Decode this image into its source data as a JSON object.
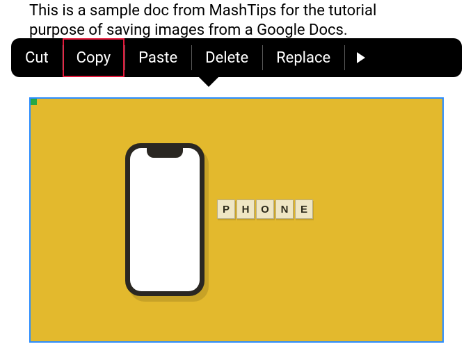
{
  "document": {
    "text_line1": "This is a sample doc from MashTips for the tutorial",
    "text_line2": "purpose of saving images from a Google Docs."
  },
  "context_menu": {
    "items": [
      {
        "label": "Cut",
        "highlighted": false
      },
      {
        "label": "Copy",
        "highlighted": true
      },
      {
        "label": "Paste",
        "highlighted": false
      },
      {
        "label": "Delete",
        "highlighted": false
      },
      {
        "label": "Replace",
        "highlighted": false
      }
    ]
  },
  "image": {
    "word_tiles": [
      "P",
      "H",
      "O",
      "N",
      "E"
    ],
    "background_color": "#e3b92d",
    "selection_color": "#2a8cff"
  }
}
